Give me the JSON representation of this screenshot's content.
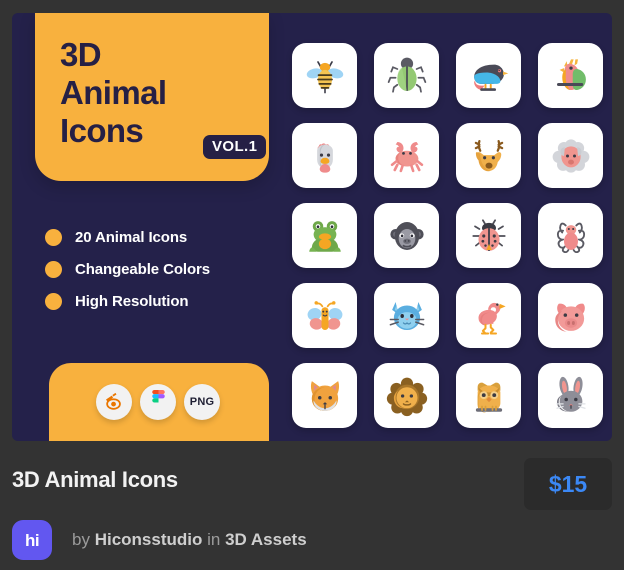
{
  "card": {
    "hero": {
      "title": "3D\nAnimal\nIcons",
      "volume_badge": "VOL.1",
      "background_color": "#f8b13e",
      "text_color": "#262045"
    },
    "features": [
      {
        "label": "20 Animal Icons"
      },
      {
        "label": "Changeable Colors"
      },
      {
        "label": "High Resolution"
      }
    ],
    "formats": [
      {
        "name": "blender-logo",
        "label": ""
      },
      {
        "name": "figma-logo",
        "label": ""
      },
      {
        "name": "png-format",
        "label": "PNG"
      }
    ],
    "background_color": "#24214a"
  },
  "icon_grid": {
    "columns": 4,
    "rows": 5,
    "icons": [
      {
        "name": "bee-icon"
      },
      {
        "name": "beetle-icon"
      },
      {
        "name": "bird-icon"
      },
      {
        "name": "parrot-icon"
      },
      {
        "name": "chicken-icon"
      },
      {
        "name": "crab-icon"
      },
      {
        "name": "deer-icon"
      },
      {
        "name": "sheep-icon"
      },
      {
        "name": "frog-icon"
      },
      {
        "name": "gorilla-icon"
      },
      {
        "name": "ladybug-icon"
      },
      {
        "name": "spider-icon"
      },
      {
        "name": "butterfly-icon"
      },
      {
        "name": "cat-icon"
      },
      {
        "name": "flamingo-icon"
      },
      {
        "name": "pig-icon"
      },
      {
        "name": "fox-icon"
      },
      {
        "name": "lion-icon"
      },
      {
        "name": "owl-icon"
      },
      {
        "name": "rabbit-icon"
      }
    ]
  },
  "meta": {
    "title": "3D Animal Icons",
    "price": "$15",
    "price_color": "#3b88f5",
    "avatar_text": "hi",
    "avatar_color": "#6257f0",
    "byline": {
      "by": "by",
      "author": "Hiconsstudio",
      "in": "in",
      "category": "3D Assets"
    }
  }
}
